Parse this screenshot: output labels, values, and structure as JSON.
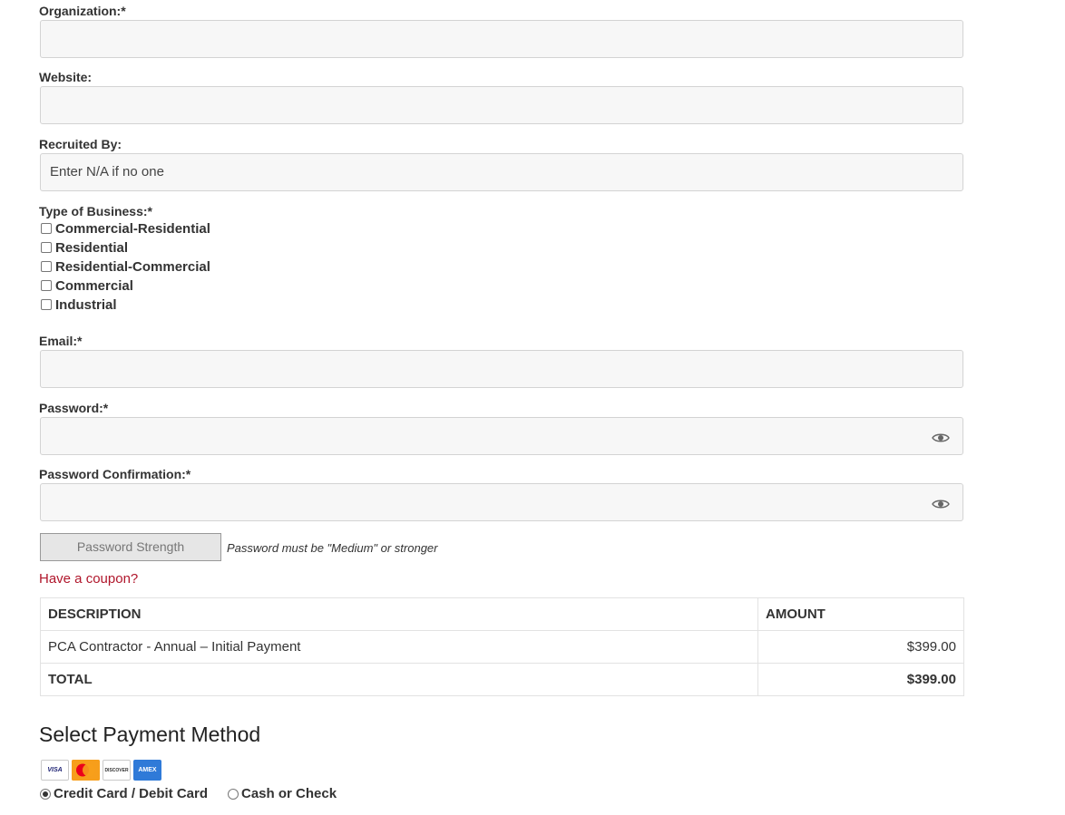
{
  "form": {
    "organization": {
      "label": "Organization:*",
      "value": ""
    },
    "website": {
      "label": "Website:",
      "value": ""
    },
    "recruited_by": {
      "label": "Recruited By:",
      "placeholder": "Enter N/A if no one"
    },
    "type_of_business": {
      "label": "Type of Business:*",
      "options": [
        {
          "label": "Commercial-Residential",
          "checked": false
        },
        {
          "label": "Residential",
          "checked": false
        },
        {
          "label": "Residential-Commercial",
          "checked": false
        },
        {
          "label": "Commercial",
          "checked": false
        },
        {
          "label": "Industrial",
          "checked": false
        }
      ]
    },
    "email": {
      "label": "Email:*",
      "value": ""
    },
    "password": {
      "label": "Password:*",
      "value": "",
      "icon": "eye-icon"
    },
    "password_confirmation": {
      "label": "Password Confirmation:*",
      "value": "",
      "icon": "eye-icon"
    },
    "password_strength": {
      "label": "Password Strength",
      "hint": "Password must be \"Medium\" or stronger"
    },
    "coupon_link": "Have a coupon?"
  },
  "order_table": {
    "headers": [
      "DESCRIPTION",
      "AMOUNT"
    ],
    "rows": [
      {
        "description": "PCA Contractor - Annual – Initial Payment",
        "amount": "$399.00"
      }
    ],
    "total": {
      "label": "TOTAL",
      "amount": "$399.00"
    }
  },
  "payment": {
    "title": "Select Payment Method",
    "cards": [
      "VISA",
      "MasterCard",
      "DISCOVER",
      "AMEX"
    ],
    "methods": [
      {
        "label": "Credit Card / Debit Card",
        "selected": true
      },
      {
        "label": "Cash or Check",
        "selected": false
      }
    ]
  },
  "colors": {
    "link": "#b0162b",
    "field_bg": "#f7f7f7",
    "field_border": "#d3d3d3"
  }
}
